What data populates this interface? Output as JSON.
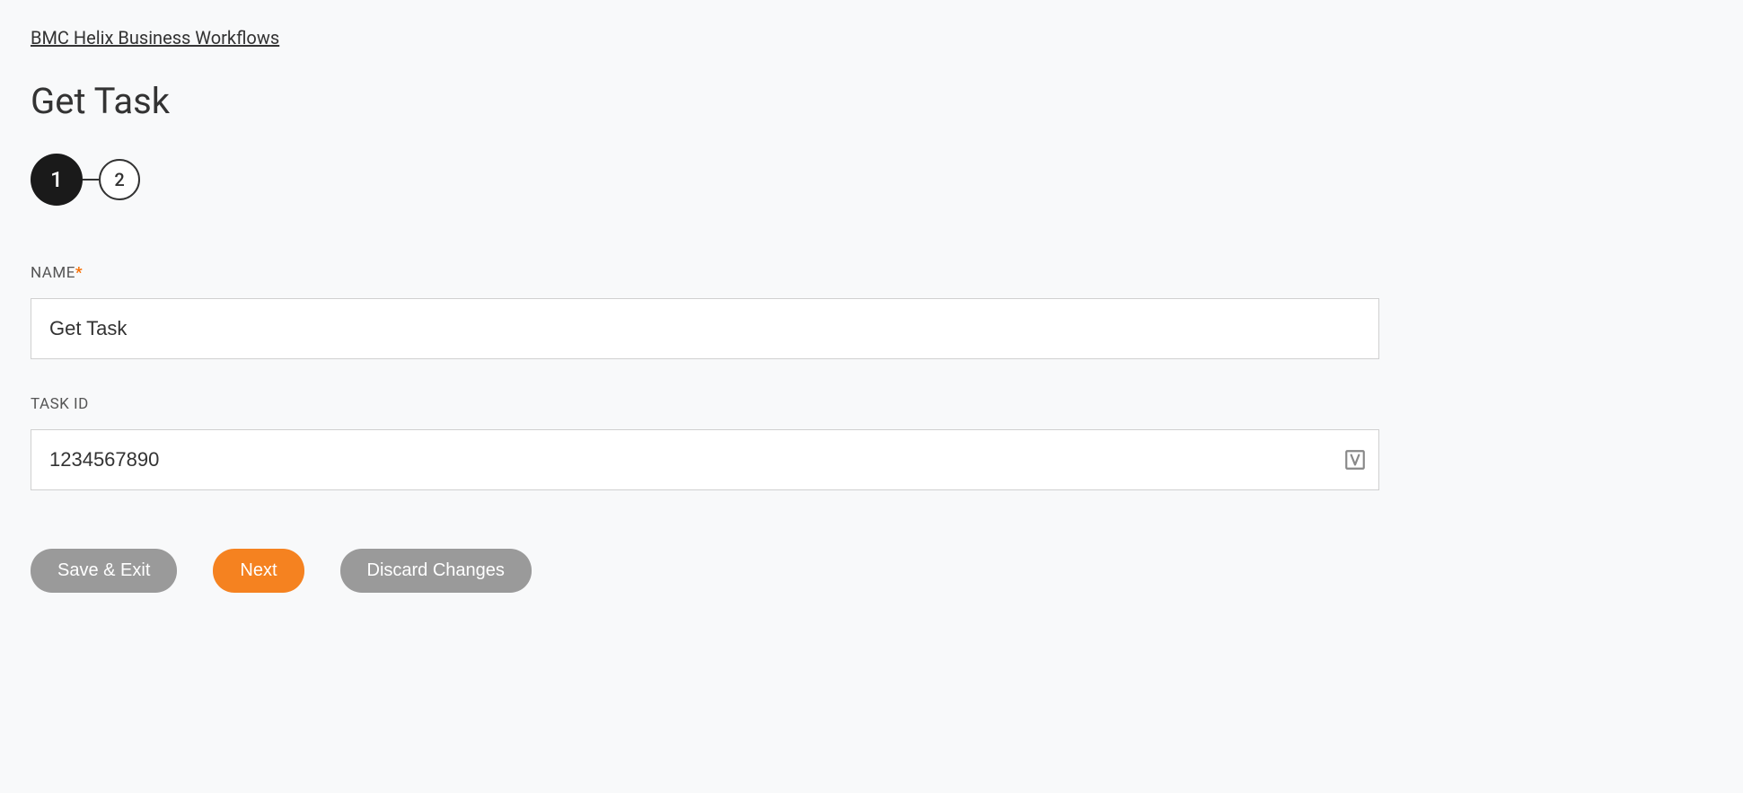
{
  "breadcrumb": {
    "label": "BMC Helix Business Workflows"
  },
  "page": {
    "title": "Get Task"
  },
  "stepper": {
    "steps": [
      "1",
      "2"
    ],
    "activeIndex": 0
  },
  "form": {
    "fields": {
      "name": {
        "label": "NAME",
        "required": "*",
        "value": "Get Task"
      },
      "taskId": {
        "label": "TASK ID",
        "value": "1234567890"
      }
    }
  },
  "buttons": {
    "saveExit": "Save & Exit",
    "next": "Next",
    "discard": "Discard Changes"
  }
}
